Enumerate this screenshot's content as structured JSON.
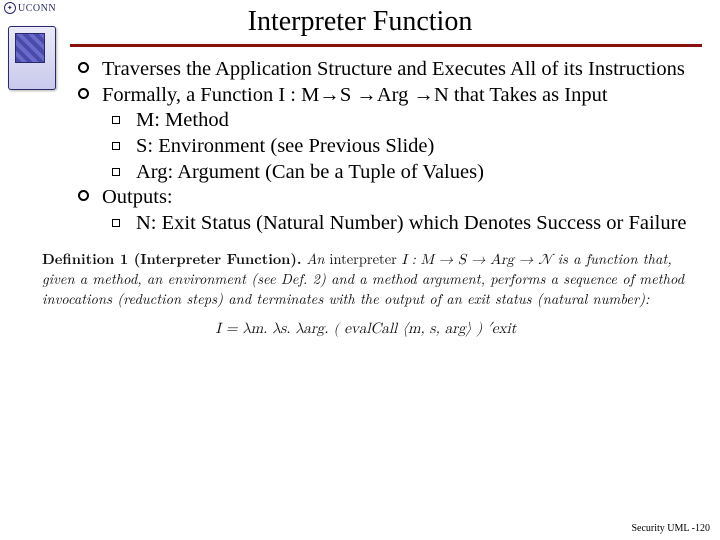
{
  "brand": {
    "name": "UCONN"
  },
  "title": "Interpreter Function",
  "bullets": {
    "b1": "Traverses the Application Structure and Executes All of its Instructions",
    "b2": "Formally, a Function I : M→S →Arg →N that Takes as Input",
    "b2a": "M: Method",
    "b2b": "S: Environment (see Previous Slide)",
    "b2c": "Arg: Argument (Can be a Tuple of Values)",
    "b3": "Outputs:",
    "b3a": "N: Exit Status (Natural Number) which Denotes Success or Failure"
  },
  "definition": {
    "label": "Definition 1 (Interpreter Function).",
    "lead_pre": "An",
    "lead_kw": "interpreter",
    "lead_sig": "I : M → S → Arg → 𝒩",
    "body": "is a function that, given a method, an environment (see Def. 2) and a method argument, performs a sequence of method invocations (reduction steps) and terminates with the output of an exit status (natural number):",
    "equation": "I = λm. λs. λarg. ( evalCall ⟨m, s, arg⟩ ) ′exit"
  },
  "footer": "Security UML -120"
}
